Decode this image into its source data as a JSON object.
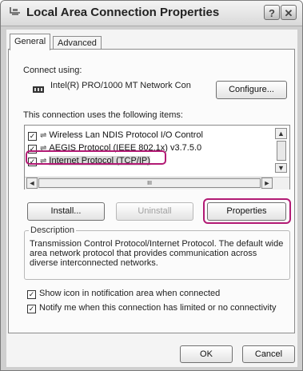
{
  "window": {
    "title": "Local Area Connection Properties",
    "title_icon": "network-connection-icon",
    "help_glyph": "?",
    "close_glyph": "✕"
  },
  "tabs": [
    {
      "label": "General",
      "selected": true
    },
    {
      "label": "Advanced",
      "selected": false
    }
  ],
  "connect_using": {
    "label": "Connect using:",
    "adapter_icon": "network-adapter-icon",
    "adapter_name": "Intel(R) PRO/1000 MT Network Con",
    "configure_label": "Configure..."
  },
  "items": {
    "label": "This connection uses the following items:",
    "rows": [
      {
        "checked": true,
        "text": "Wireless Lan NDIS Protocol I/O Control",
        "selected": false
      },
      {
        "checked": true,
        "text": "AEGIS Protocol (IEEE 802.1x) v3.7.5.0",
        "selected": false
      },
      {
        "checked": true,
        "text": "Internet Protocol (TCP/IP)",
        "selected": true
      }
    ],
    "scroll_thumb_glyph": "III"
  },
  "buttons": {
    "install": "Install...",
    "uninstall": "Uninstall",
    "properties": "Properties",
    "ok": "OK",
    "cancel": "Cancel"
  },
  "description": {
    "label": "Description",
    "text": "Transmission Control Protocol/Internet Protocol. The default wide area network protocol that provides communication across diverse interconnected networks."
  },
  "options": [
    {
      "checked": true,
      "label": "Show icon in notification area when connected"
    },
    {
      "checked": true,
      "label": "Notify me when this connection has limited or no connectivity"
    }
  ],
  "colors": {
    "highlight": "#b21a74",
    "panel": "#fbfbfb",
    "titlebar": "#e6e6e6"
  }
}
